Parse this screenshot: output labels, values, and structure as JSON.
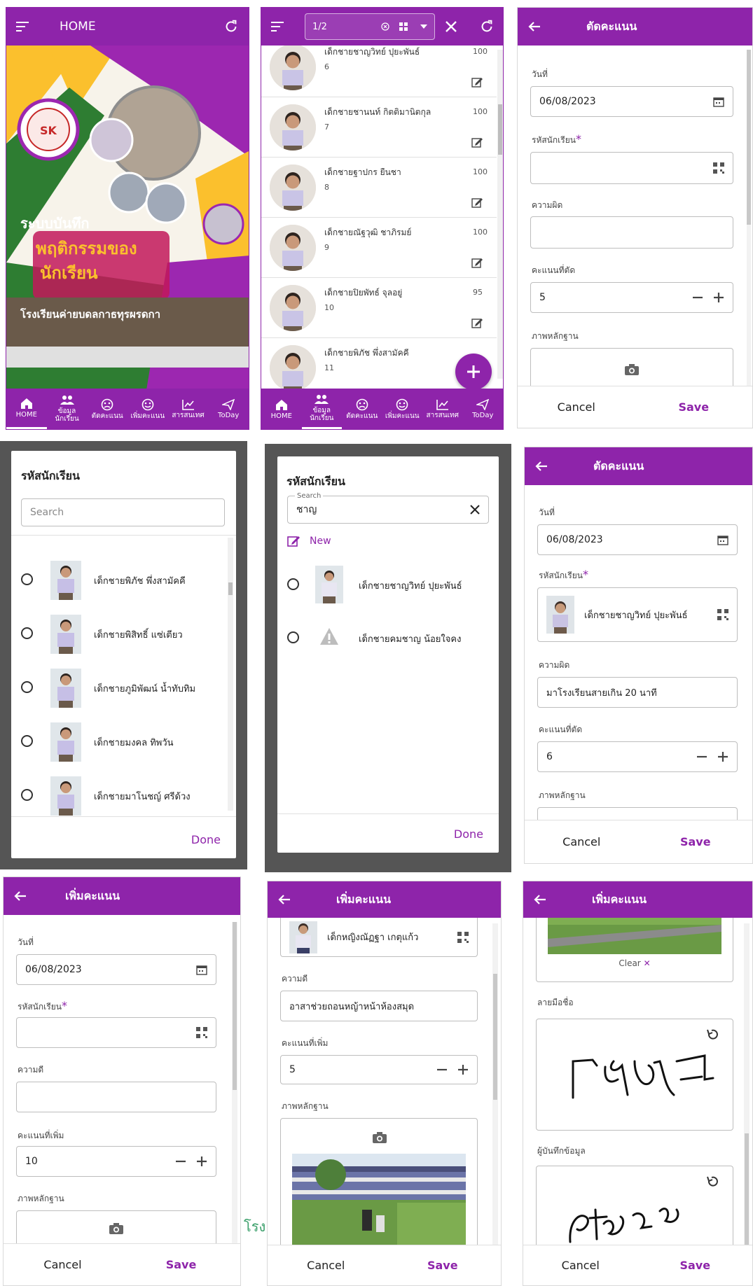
{
  "colors": {
    "primary": "#8e24aa",
    "white": "#ffffff"
  },
  "p1": {
    "title": "HOME",
    "banner": {
      "text1": "ระบบบันทึก",
      "text2": "พฤติกรรมของ",
      "text3": "นักเรียน",
      "school": "โรงเรียนค่ายบดลกาธทุรผรดกา",
      "logo": "SK"
    },
    "nav": [
      {
        "label": "HOME",
        "icon": "home-icon"
      },
      {
        "label": "ข้อมูล\nนักเรียน",
        "icon": "users-icon"
      },
      {
        "label": "ตัดคะแนน",
        "icon": "sad-icon"
      },
      {
        "label": "เพิ่มคะแนน",
        "icon": "smile-icon"
      },
      {
        "label": "สารสนเทศ",
        "icon": "chart-icon"
      },
      {
        "label": "ToDay",
        "icon": "send-icon"
      }
    ]
  },
  "p2": {
    "page": "1/2",
    "students": [
      {
        "name": "เด็กชายชาญวิทย์ ปุยะพันธ์",
        "no": "6",
        "score": "100"
      },
      {
        "name": "เด็กชายชานนท์ กิตติมานิตกุล",
        "no": "7",
        "score": "100"
      },
      {
        "name": "เด็กชายฐาปกร ยืนชา",
        "no": "8",
        "score": "100"
      },
      {
        "name": "เด็กชายณัฐวุฒิ ชาภิรมย์",
        "no": "9",
        "score": "100"
      },
      {
        "name": "เด็กชายปิยพัทธ์ จุลอยู่",
        "no": "10",
        "score": "95"
      },
      {
        "name": "เด็กชายพิภัช พึ่งสามัคคี",
        "no": "11",
        "score": ""
      }
    ]
  },
  "p3": {
    "title": "ตัดคะแนน",
    "date_label": "วันที่",
    "date": "06/08/2023",
    "student_label": "รหัสนักเรียน",
    "required": "*",
    "fault_label": "ความผิด",
    "points_label": "คะแนนที่ตัด",
    "points": "5",
    "evidence_label": "ภาพหลักฐาน",
    "cancel": "Cancel",
    "save": "Save"
  },
  "p4": {
    "title": "รหัสนักเรียน",
    "search_placeholder": "Search",
    "items": [
      "เด็กชายพิภัช พึ่งสามัคคี",
      "เด็กชายพิสิทธิ์ แซ่เตียว",
      "เด็กชายภูมิพัฒน์ น้ำทับทิม",
      "เด็กชายมงคล ทิพวัน",
      "เด็กชายมาโนชญ์ ศรีด้วง"
    ],
    "done": "Done"
  },
  "p5": {
    "title": "รหัสนักเรียน",
    "search_label": "Search",
    "search_value": "ชาญ",
    "new": "New",
    "items": [
      "เด็กชายชาญวิทย์ ปุยะพันธ์",
      "เด็กชายคมชาญ น้อยใจคง"
    ],
    "done": "Done"
  },
  "p6": {
    "title": "ตัดคะแนน",
    "date_label": "วันที่",
    "date": "06/08/2023",
    "student_label": "รหัสนักเรียน",
    "required": "*",
    "student": "เด็กชายชาญวิทย์ ปุยะพันธ์",
    "fault_label": "ความผิด",
    "fault": "มาโรงเรียนสายเกิน 20 นาที",
    "points_label": "คะแนนที่ตัด",
    "points": "6",
    "evidence_label": "ภาพหลักฐาน",
    "cancel": "Cancel",
    "save": "Save"
  },
  "p7": {
    "title": "เพิ่มคะแนน",
    "date_label": "วันที่",
    "date": "06/08/2023",
    "student_label": "รหัสนักเรียน",
    "required": "*",
    "good_label": "ความดี",
    "points_label": "คะแนนที่เพิ่ม",
    "points": "10",
    "evidence_label": "ภาพหลักฐาน",
    "cancel": "Cancel",
    "save": "Save",
    "side_text": "โรง"
  },
  "p8": {
    "title": "เพิ่มคะแนน",
    "student": "เด็กหญิงณัฏฐา เกตุแก้ว",
    "good_label": "ความดี",
    "good": "อาสาช่วยถอนหญ้าหน้าห้องสมุด",
    "points_label": "คะแนนที่เพิ่ม",
    "points": "5",
    "evidence_label": "ภาพหลักฐาน",
    "cancel": "Cancel",
    "save": "Save"
  },
  "p9": {
    "title": "เพิ่มคะแนน",
    "clear": "Clear",
    "sign_label": "ลายมือชื่อ",
    "recorder_label": "ผู้บันทึกข้อมูล",
    "cancel": "Cancel",
    "save": "Save"
  }
}
